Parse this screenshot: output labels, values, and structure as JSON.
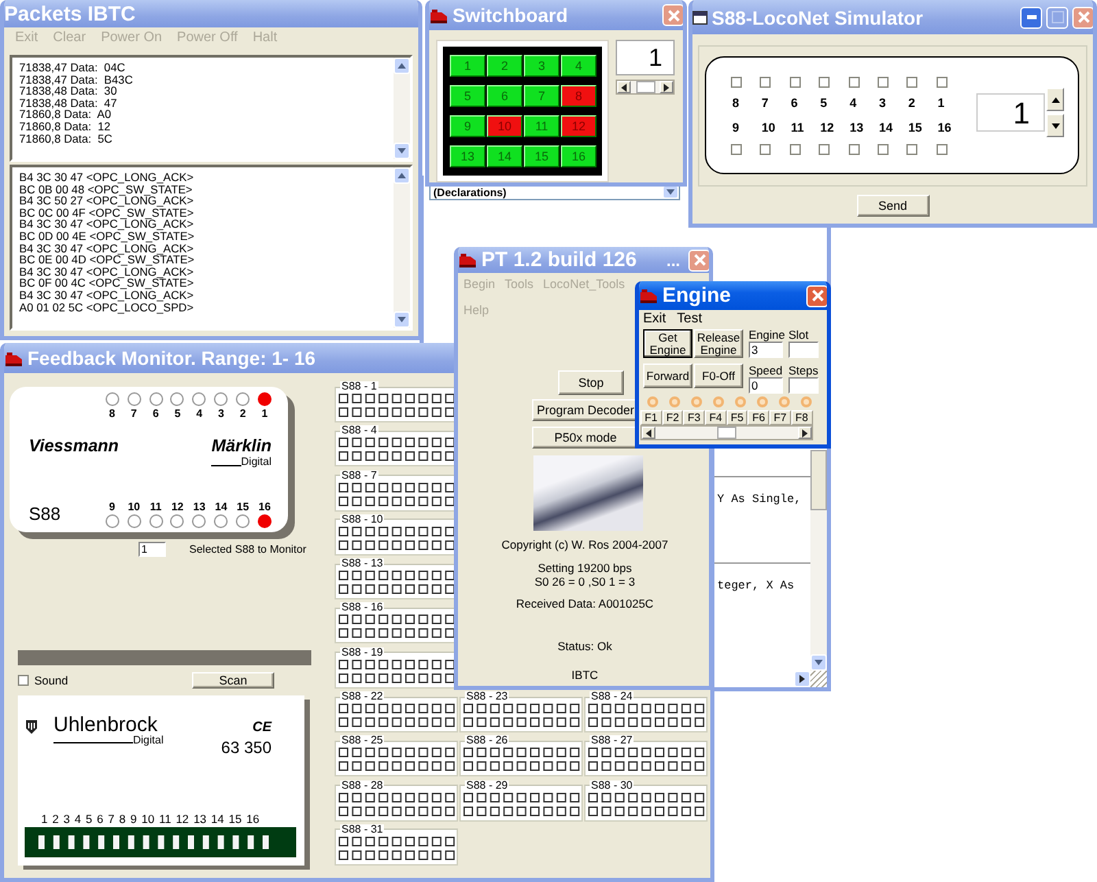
{
  "packets": {
    "title": "Packets IBTC",
    "active": false,
    "menu": [
      {
        "label": "Exit",
        "disabled": true
      },
      {
        "label": "Clear",
        "disabled": true
      },
      {
        "label": "Power On",
        "disabled": true
      },
      {
        "label": "Power Off",
        "disabled": true
      },
      {
        "label": "Halt",
        "disabled": true
      }
    ],
    "log": [
      "71838,47 Data:  04C",
      "71838,47 Data:  B43C",
      "71838,48 Data:  30",
      "71838,48 Data:  47",
      "71860,8 Data:  A0",
      "71860,8 Data:  12",
      "71860,8 Data:  5C"
    ],
    "messages": [
      "B4 3C 30 47 <OPC_LONG_ACK>",
      "BC 0B 00 48 <OPC_SW_STATE>",
      "B4 3C 50 27 <OPC_LONG_ACK>",
      "BC 0C 00 4F <OPC_SW_STATE>",
      "B4 3C 30 47 <OPC_LONG_ACK>",
      "BC 0D 00 4E <OPC_SW_STATE>",
      "B4 3C 30 47 <OPC_LONG_ACK>",
      "BC 0E 00 4D <OPC_SW_STATE>",
      "B4 3C 30 47 <OPC_LONG_ACK>",
      "BC 0F 00 4C <OPC_SW_STATE>",
      "B4 3C 30 47 <OPC_LONG_ACK>",
      "A0 01 02 5C <OPC_LOCO_SPD>"
    ]
  },
  "switchboard": {
    "title": "Switchboard",
    "active": false,
    "switches": [
      {
        "label": "1",
        "on": true
      },
      {
        "label": "2",
        "on": true
      },
      {
        "label": "3",
        "on": true
      },
      {
        "label": "4",
        "on": true
      },
      {
        "label": "5",
        "on": true
      },
      {
        "label": "6",
        "on": true
      },
      {
        "label": "7",
        "on": true
      },
      {
        "label": "8",
        "on": false
      },
      {
        "label": "9",
        "on": true
      },
      {
        "label": "10",
        "on": false
      },
      {
        "label": "11",
        "on": true
      },
      {
        "label": "12",
        "on": false
      },
      {
        "label": "13",
        "on": true
      },
      {
        "label": "14",
        "on": true
      },
      {
        "label": "15",
        "on": true
      },
      {
        "label": "16",
        "on": true
      }
    ],
    "address": "1"
  },
  "code_window": {
    "procedure": "(Declarations)",
    "lines": [
      "Y As Single,",
      "teger, X As"
    ]
  },
  "simulator": {
    "title": "S88-LocoNet Simulator",
    "active": false,
    "top_inputs": [
      {
        "label": "8",
        "checked": false
      },
      {
        "label": "7",
        "checked": false
      },
      {
        "label": "6",
        "checked": false
      },
      {
        "label": "5",
        "checked": false
      },
      {
        "label": "4",
        "checked": false
      },
      {
        "label": "3",
        "checked": false
      },
      {
        "label": "2",
        "checked": false
      },
      {
        "label": "1",
        "checked": false
      }
    ],
    "bottom_inputs": [
      {
        "label": "9",
        "checked": false
      },
      {
        "label": "10",
        "checked": false
      },
      {
        "label": "11",
        "checked": false
      },
      {
        "label": "12",
        "checked": false
      },
      {
        "label": "13",
        "checked": false
      },
      {
        "label": "14",
        "checked": false
      },
      {
        "label": "15",
        "checked": false
      },
      {
        "label": "16",
        "checked": false
      }
    ],
    "module": "1",
    "send": "Send"
  },
  "feedback": {
    "title": "Feedback Monitor. Range: 1- 16",
    "active": false,
    "s88": {
      "brand": "Viessmann",
      "maker": "Märklin",
      "maker_sub": "Digital",
      "model": "S88",
      "top": [
        {
          "label": "8",
          "on": false
        },
        {
          "label": "7",
          "on": false
        },
        {
          "label": "6",
          "on": false
        },
        {
          "label": "5",
          "on": false
        },
        {
          "label": "4",
          "on": false
        },
        {
          "label": "3",
          "on": false
        },
        {
          "label": "2",
          "on": false
        },
        {
          "label": "1",
          "on": true
        }
      ],
      "bottom": [
        {
          "label": "9",
          "on": false
        },
        {
          "label": "10",
          "on": false
        },
        {
          "label": "11",
          "on": false
        },
        {
          "label": "12",
          "on": false
        },
        {
          "label": "13",
          "on": false
        },
        {
          "label": "14",
          "on": false
        },
        {
          "label": "15",
          "on": false
        },
        {
          "label": "16",
          "on": true
        }
      ]
    },
    "module": "1",
    "module_label": "Selected S88 to Monitor",
    "sound": {
      "label": "Sound",
      "checked": false
    },
    "scan": "Scan",
    "uhlenbrock": {
      "brand": "Uhlenbrock",
      "sub": "Digital",
      "mark": "CE",
      "model": "63 350",
      "inputs": [
        "1",
        "2",
        "3",
        "4",
        "5",
        "6",
        "7",
        "8",
        "9",
        "10",
        "11",
        "12",
        "13",
        "14",
        "15",
        "16"
      ]
    },
    "group_rows": [
      [
        "S88 - 1"
      ],
      [
        "S88 - 4"
      ],
      [
        "S88 - 7"
      ],
      [
        "S88 - 10"
      ],
      [
        "S88 - 13"
      ],
      [
        "S88 - 16"
      ],
      [
        "S88 - 19"
      ],
      [
        "S88 - 22",
        "S88 - 23",
        "S88 - 24"
      ],
      [
        "S88 - 25",
        "S88 - 26",
        "S88 - 27"
      ],
      [
        "S88 - 28",
        "S88 - 29",
        "S88 - 30"
      ],
      [
        "S88 - 31"
      ]
    ]
  },
  "pt": {
    "title": "PT 1.2 build 126",
    "title_extra": "...",
    "active": false,
    "menu": [
      {
        "label": "Begin",
        "disabled": true
      },
      {
        "label": "Tools",
        "disabled": true
      },
      {
        "label": "LocoNet_Tools",
        "disabled": true
      },
      {
        "label": "Help",
        "disabled": true
      }
    ],
    "buttons": [
      "Stop",
      "Program Decoder",
      "P50x mode"
    ],
    "info": [
      "Copyright (c) W. Ros 2004-2007",
      "Setting 19200 bps",
      "S0 26 = 0 ,S0 1 = 3",
      "Received Data: A001025C",
      "Status: Ok",
      "IBTC"
    ]
  },
  "engine": {
    "title": "Engine",
    "active": true,
    "menu": [
      "Exit",
      "Test"
    ],
    "buttons": [
      {
        "label": "Get Engine",
        "focused": true
      },
      {
        "label": "Release Engine",
        "focused": false
      },
      {
        "label": "Forward",
        "focused": false
      },
      {
        "label": "F0-Off",
        "focused": false
      }
    ],
    "fields": [
      {
        "label": "Engine",
        "value": "3"
      },
      {
        "label": "Slot"
      },
      {
        "label": "Speed",
        "value": "0"
      },
      {
        "label": "Steps"
      }
    ],
    "functions": [
      "F1",
      "F2",
      "F3",
      "F4",
      "F5",
      "F6",
      "F7",
      "F8"
    ]
  }
}
